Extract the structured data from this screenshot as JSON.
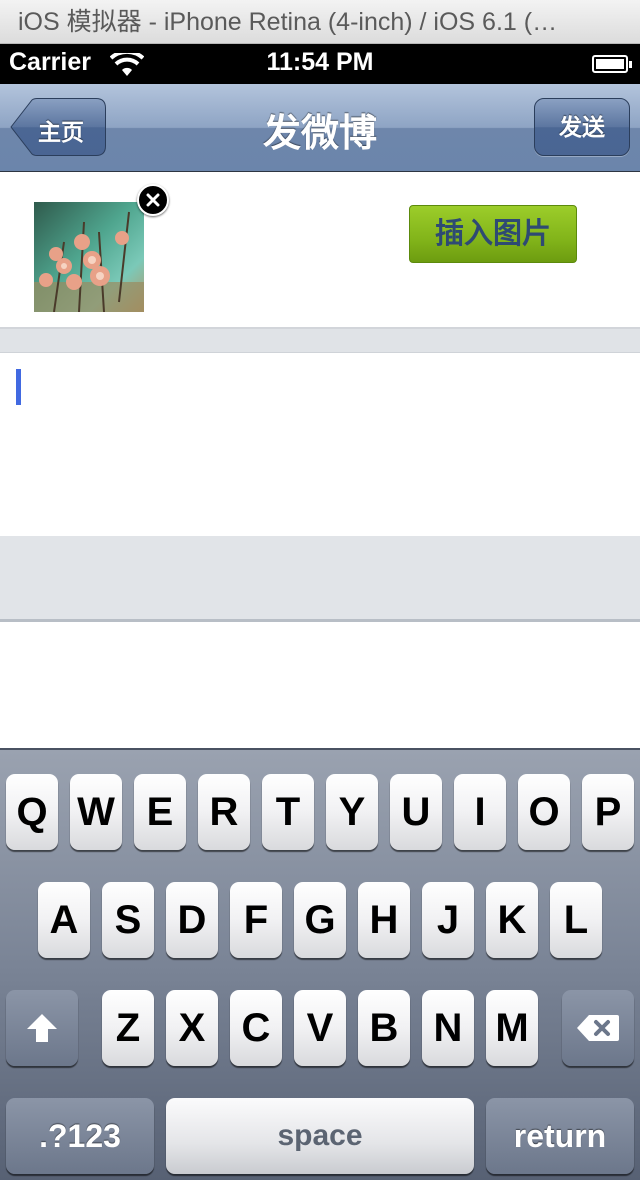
{
  "simulator": {
    "title": "iOS 模拟器 - iPhone Retina (4-inch) / iOS 6.1 (…"
  },
  "status_bar": {
    "carrier": "Carrier",
    "time": "11:54 PM"
  },
  "nav": {
    "back_label": "主页",
    "title": "发微博",
    "send_label": "发送"
  },
  "compose": {
    "insert_image_label": "插入图片",
    "text_value": ""
  },
  "keyboard": {
    "row1": [
      "Q",
      "W",
      "E",
      "R",
      "T",
      "Y",
      "U",
      "I",
      "O",
      "P"
    ],
    "row2": [
      "A",
      "S",
      "D",
      "F",
      "G",
      "H",
      "J",
      "K",
      "L"
    ],
    "row3": [
      "Z",
      "X",
      "C",
      "V",
      "B",
      "N",
      "M"
    ],
    "num_label": ".?123",
    "space_label": "space",
    "return_label": "return"
  },
  "colors": {
    "nav_tint": "#6b85ab",
    "insert_button": "#82b41a",
    "cursor": "#4169e1"
  }
}
